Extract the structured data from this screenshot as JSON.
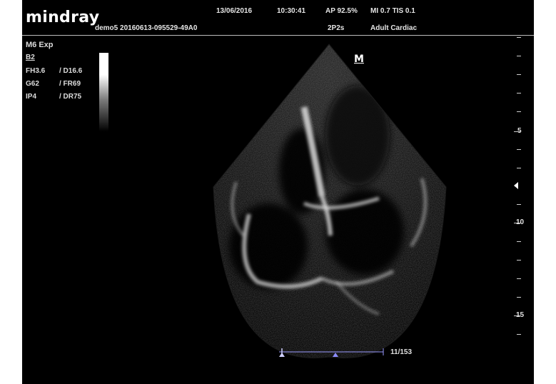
{
  "header": {
    "brand": "mindray",
    "patient_id": "demo5 20160613-095529-49A0",
    "date": "13/06/2016",
    "time": "10:30:41",
    "ap": "AP 92.5%",
    "mi_tis": "MI 0.7  TIS 0.1",
    "preset_code": "2P2s",
    "exam": "Adult Cardiac"
  },
  "params": {
    "mode": "M6 Exp",
    "mode2": "B2",
    "fh": "FH3.6",
    "d": "/ D16.6",
    "g": "G62",
    "fr": "/ FR69",
    "ip": "IP4",
    "dr": "/ DR75"
  },
  "orientation_marker": "M",
  "depth_labels": [
    "5",
    "10",
    "15"
  ],
  "cine": {
    "frame": "11/153",
    "progress": 0.07
  },
  "colors": {
    "background": "#000000",
    "cine_accent": "#8c8cff",
    "text": "#e6e6e6"
  },
  "icons": [
    "focus-marker-icon",
    "cine-cursor-icon"
  ]
}
